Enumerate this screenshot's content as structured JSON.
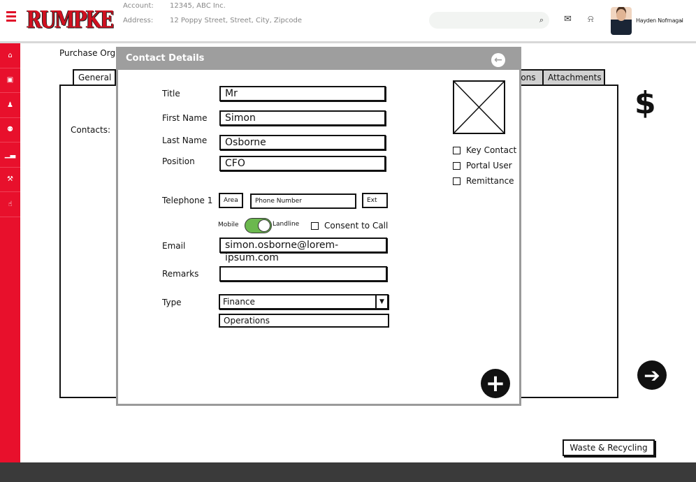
{
  "header": {
    "account_label": "Account:",
    "account_value": "12345, ABC Inc.",
    "address_label": "Address:",
    "address_value": "12 Poppy Street, Street, City, Zipcode",
    "logo_text": "RUMPKE",
    "user_name": "Hayden Nofrnagal"
  },
  "background": {
    "purchase_label": "Purchase Org",
    "tabs": [
      "General",
      "ions",
      "Attachments"
    ],
    "contacts_label": "Contacts:",
    "currency_symbol": "$",
    "waste_button": "Waste & Recycling"
  },
  "modal": {
    "title": "Contact Details",
    "fields": {
      "title_label": "Title",
      "title_value": "Mr",
      "first_name_label": "First Name",
      "first_name_value": "Simon",
      "last_name_label": "Last Name",
      "last_name_value": "Osborne",
      "position_label": "Position",
      "position_value": "CFO",
      "telephone_label": "Telephone 1",
      "area_placeholder": "Area",
      "phone_placeholder": "Phone Number",
      "ext_placeholder": "Ext",
      "mobile_label": "Mobile",
      "landline_label": "Landline",
      "consent_label": "Consent to Call",
      "email_label": "Email",
      "email_value": "simon.osborne@lorem-ipsum.com",
      "remarks_label": "Remarks",
      "remarks_value": "",
      "type_label": "Type",
      "type_value": "Finance",
      "type_option": "Operations"
    },
    "checkboxes": [
      "Key Contact",
      "Portal User",
      "Remittance"
    ]
  },
  "colors": {
    "sidebar": "#e8102c",
    "modal_header": "#9e9e9e",
    "toggle_on": "#6bb84e"
  }
}
